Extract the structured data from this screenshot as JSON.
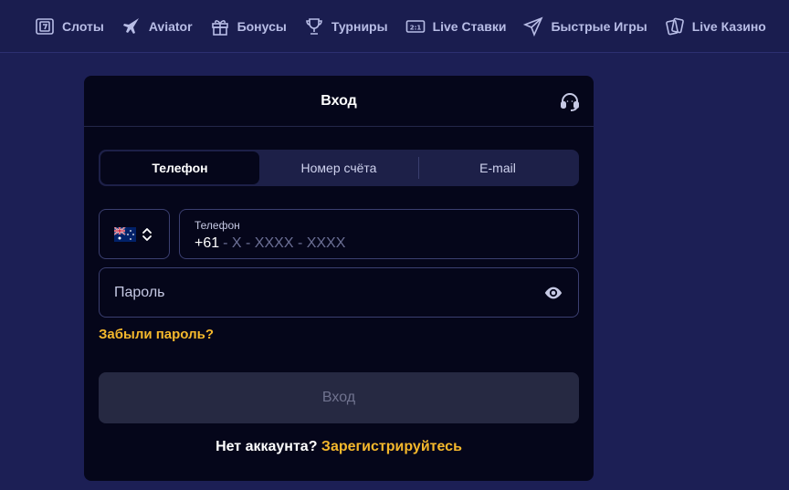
{
  "nav": {
    "items": [
      {
        "label": "Слоты",
        "icon": "slots-icon"
      },
      {
        "label": "Aviator",
        "icon": "plane-icon"
      },
      {
        "label": "Бонусы",
        "icon": "gift-icon"
      },
      {
        "label": "Турниры",
        "icon": "trophy-icon"
      },
      {
        "label": "Live Ставки",
        "icon": "scoreboard-icon"
      },
      {
        "label": "Быстрые Игры",
        "icon": "paper-plane-icon"
      },
      {
        "label": "Live Казино",
        "icon": "cards-icon"
      }
    ]
  },
  "modal": {
    "title": "Вход",
    "support_icon": "headset-icon",
    "tabs": [
      {
        "label": "Телефон",
        "active": true
      },
      {
        "label": "Номер счёта",
        "active": false
      },
      {
        "label": "E-mail",
        "active": false
      }
    ],
    "country": {
      "flag": "australia-flag",
      "icon": "chevron-updown-icon"
    },
    "phone": {
      "label": "Телефон",
      "code": "+61",
      "mask": "- X - XXXX - XXXX"
    },
    "password": {
      "placeholder": "Пароль",
      "icon": "eye-icon"
    },
    "forgot_label": "Забыли пароль?",
    "submit_label": "Вход",
    "register": {
      "prompt": "Нет аккаунта?",
      "link": "Зарегистрируйтесь"
    }
  },
  "colors": {
    "background": "#1c1f55",
    "modal": "#05061a",
    "accent": "#f5b82c"
  }
}
